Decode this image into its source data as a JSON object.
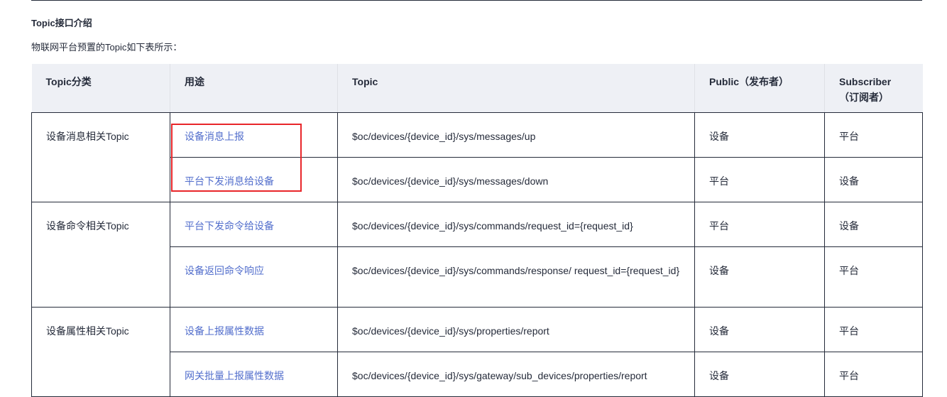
{
  "section_title": "Topic接口介绍",
  "intro_text": "物联网平台预置的Topic如下表所示：",
  "table": {
    "headers": [
      "Topic分类",
      "用途",
      "Topic",
      "Public（发布者）",
      "Subscriber（订阅者）"
    ],
    "groups": [
      {
        "category": "设备消息相关Topic",
        "rows": [
          {
            "purpose": "设备消息上报",
            "topic": "$oc/devices/{device_id}/sys/messages/up",
            "publisher": "设备",
            "subscriber": "平台"
          },
          {
            "purpose": "平台下发消息给设备",
            "topic": "$oc/devices/{device_id}/sys/messages/down",
            "publisher": "平台",
            "subscriber": "设备"
          }
        ]
      },
      {
        "category": "设备命令相关Topic",
        "rows": [
          {
            "purpose": "平台下发命令给设备",
            "topic": "$oc/devices/{device_id}/sys/commands/request_id={request_id}",
            "publisher": "平台",
            "subscriber": "设备"
          },
          {
            "purpose": "设备返回命令响应",
            "topic": "$oc/devices/{device_id}/sys/commands/response/ request_id={request_id}",
            "publisher": "设备",
            "subscriber": "平台"
          }
        ]
      },
      {
        "category": "设备属性相关Topic",
        "rows": [
          {
            "purpose": "设备上报属性数据",
            "topic": "$oc/devices/{device_id}/sys/properties/report",
            "publisher": "设备",
            "subscriber": "平台"
          },
          {
            "purpose": "网关批量上报属性数据",
            "topic": "$oc/devices/{device_id}/sys/gateway/sub_devices/properties/report",
            "publisher": "设备",
            "subscriber": "平台"
          }
        ]
      }
    ]
  },
  "colors": {
    "link": "#526ecc",
    "header_bg": "#eef0f5",
    "highlight": "#e8262a",
    "text": "#252b3a"
  }
}
